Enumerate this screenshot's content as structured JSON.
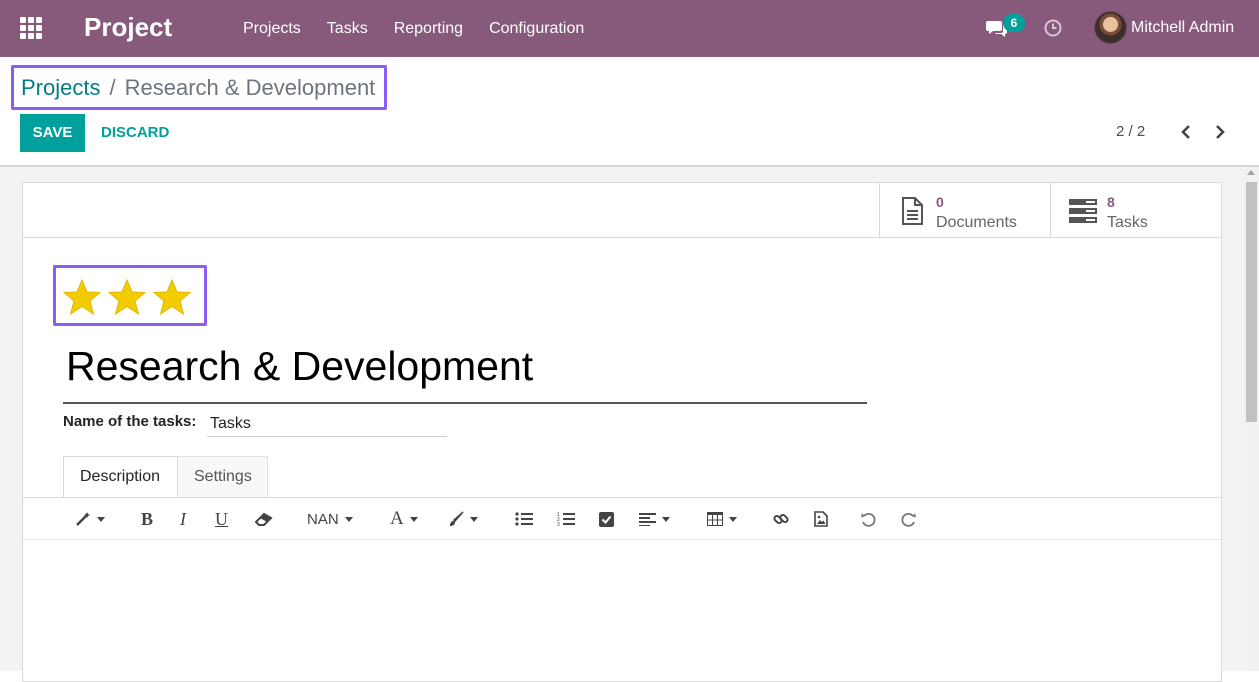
{
  "navbar": {
    "app_title": "Project",
    "menu": [
      "Projects",
      "Tasks",
      "Reporting",
      "Configuration"
    ],
    "messages_count": "6",
    "user_name": "Mitchell Admin",
    "bg_color": "#875a7b"
  },
  "breadcrumb": {
    "parent": "Projects",
    "separator": "/",
    "current": "Research & Development"
  },
  "actions": {
    "save_label": "SAVE",
    "discard_label": "DISCARD"
  },
  "pager": {
    "value": "2 / 2"
  },
  "stat_buttons": {
    "documents": {
      "value": "0",
      "label": "Documents",
      "icon": "document-icon"
    },
    "tasks": {
      "value": "8",
      "label": "Tasks",
      "icon": "tasks-list-icon"
    }
  },
  "record": {
    "priority_stars": 3,
    "priority_max": 3,
    "title": "Research & Development",
    "tasks_label": "Name of the tasks:",
    "tasks_value": "Tasks"
  },
  "tabs": [
    {
      "label": "Description",
      "active": true
    },
    {
      "label": "Settings",
      "active": false
    }
  ],
  "toolbar": {
    "font_size_label": "NAN",
    "buttons": [
      "magic-wand",
      "bold",
      "italic",
      "underline",
      "eraser",
      "font-size",
      "font-color",
      "highlight-color",
      "bullet-list",
      "numbered-list",
      "checklist",
      "align",
      "table",
      "link",
      "image",
      "undo",
      "redo"
    ]
  },
  "colors": {
    "accent": "#00a09d",
    "star": "#f3cc00",
    "highlight_box": "#8b5cf6"
  }
}
